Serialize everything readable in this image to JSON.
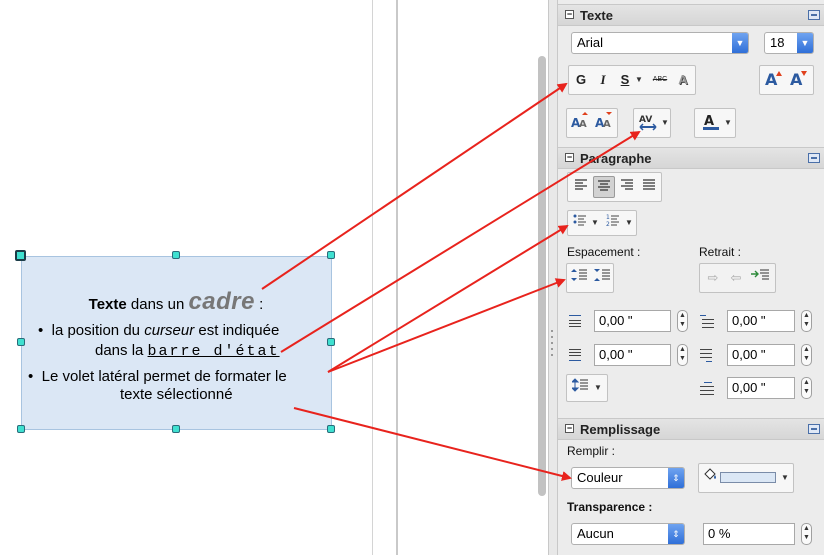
{
  "document": {
    "frame_title_bold": "Texte",
    "frame_title_mid": " dans un ",
    "frame_title_big": "cadre",
    "frame_title_end": " :",
    "bullet1_a": "la position du ",
    "bullet1_italic": "curseur",
    "bullet1_b": " est indiquée",
    "bullet1_line2": "dans la ",
    "bullet1_mono": "barre d'état",
    "bullet2_line1": "Le volet latéral permet de formater le",
    "bullet2_line2": "texte sélectionné",
    "bullet_char": "•"
  },
  "panel": {
    "texte": {
      "title": "Texte",
      "font_name": "Arial",
      "font_size": "18",
      "bold": "G",
      "italic": "I",
      "underline": "S",
      "strike": "ABC",
      "shadow": "A"
    },
    "paragraphe": {
      "title": "Paragraphe",
      "espacement_label": "Espacement :",
      "retrait_label": "Retrait :",
      "above_spacing": "0,00 \"",
      "below_spacing": "0,00 \"",
      "indent_before": "0,00 \"",
      "indent_after": "0,00 \"",
      "first_line": "0,00 \""
    },
    "remplissage": {
      "title": "Remplissage",
      "remplir_label": "Remplir :",
      "fill_type": "Couleur",
      "transparence_label": "Transparence :",
      "transparence_type": "Aucun",
      "transparence_value": "0 %",
      "fill_color": "#dbe7f5"
    }
  },
  "colors": {
    "arrow": "#e8231d",
    "frame_bg": "#dbe7f5",
    "handle": "#3fe0d0",
    "combo_button": "#2f6fd8"
  }
}
